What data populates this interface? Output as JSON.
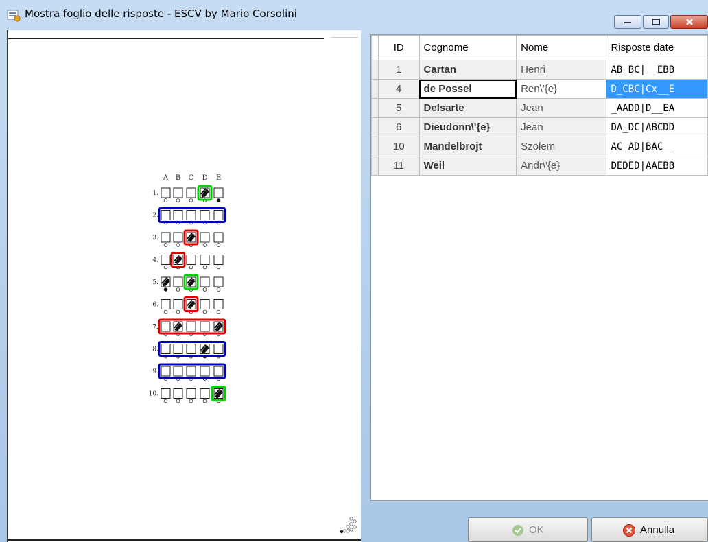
{
  "window": {
    "title": "Mostra foglio delle risposte - ESCV by Mario Corsolini",
    "colors": {
      "accent": "#3399ff",
      "frame": "#b9d1ea"
    }
  },
  "answer_sheet": {
    "column_letters": [
      "A",
      "B",
      "C",
      "D",
      "E"
    ],
    "questions": [
      {
        "number": "1.",
        "filled": [
          3
        ],
        "dots": [
          4
        ],
        "box": {
          "type": "single",
          "col": 3,
          "color": "#00d000"
        }
      },
      {
        "number": "2.",
        "filled": [],
        "dots": [],
        "box": {
          "type": "row",
          "color": "#0000c0"
        }
      },
      {
        "number": "3.",
        "filled": [
          2
        ],
        "dots": [],
        "box": {
          "type": "single",
          "col": 2,
          "color": "#e00000"
        }
      },
      {
        "number": "4.",
        "filled": [
          1
        ],
        "dots": [],
        "box": {
          "type": "single",
          "col": 1,
          "color": "#e00000"
        }
      },
      {
        "number": "5.",
        "filled": [
          0,
          2
        ],
        "dots": [
          0
        ],
        "box": {
          "type": "single",
          "col": 2,
          "color": "#00d000"
        }
      },
      {
        "number": "6.",
        "filled": [
          2
        ],
        "dots": [],
        "box": {
          "type": "single",
          "col": 2,
          "color": "#e00000"
        }
      },
      {
        "number": "7.",
        "filled": [
          1,
          4
        ],
        "dots": [],
        "box": {
          "type": "row",
          "color": "#e00000"
        }
      },
      {
        "number": "8.",
        "filled": [
          3
        ],
        "dots": [
          3
        ],
        "box": {
          "type": "row",
          "color": "#0000c0"
        }
      },
      {
        "number": "9.",
        "filled": [],
        "dots": [],
        "box": {
          "type": "row",
          "color": "#0000c0"
        }
      },
      {
        "number": "10.",
        "filled": [
          4
        ],
        "dots": [],
        "box": {
          "type": "single",
          "col": 4,
          "color": "#00d000"
        }
      }
    ]
  },
  "grid": {
    "headers": [
      "ID",
      "Cognome",
      "Nome",
      "Risposte date"
    ],
    "rows": [
      {
        "id": "1",
        "cognome": "Cartan",
        "nome": "Henri",
        "risposte": "AB_BC|__EBB",
        "selected": false
      },
      {
        "id": "4",
        "cognome": "de Possel",
        "nome": "Ren\\'{e}",
        "risposte": "D_CBC|Cx__E",
        "selected": true
      },
      {
        "id": "5",
        "cognome": "Delsarte",
        "nome": "Jean",
        "risposte": "_AADD|D__EA",
        "selected": false
      },
      {
        "id": "6",
        "cognome": "Dieudonn\\'{e}",
        "nome": "Jean",
        "risposte": "DA_DC|ABCDD",
        "selected": false
      },
      {
        "id": "10",
        "cognome": "Mandelbrojt",
        "nome": "Szolem",
        "risposte": "AC_AD|BAC__",
        "selected": false
      },
      {
        "id": "11",
        "cognome": "Weil",
        "nome": "Andr\\'{e}",
        "risposte": "DEDED|AAEBB",
        "selected": false
      }
    ]
  },
  "buttons": {
    "ok_label": "OK",
    "ok_icon": "check-circle-icon",
    "cancel_label": "Annulla",
    "cancel_icon": "cancel-x-icon"
  }
}
